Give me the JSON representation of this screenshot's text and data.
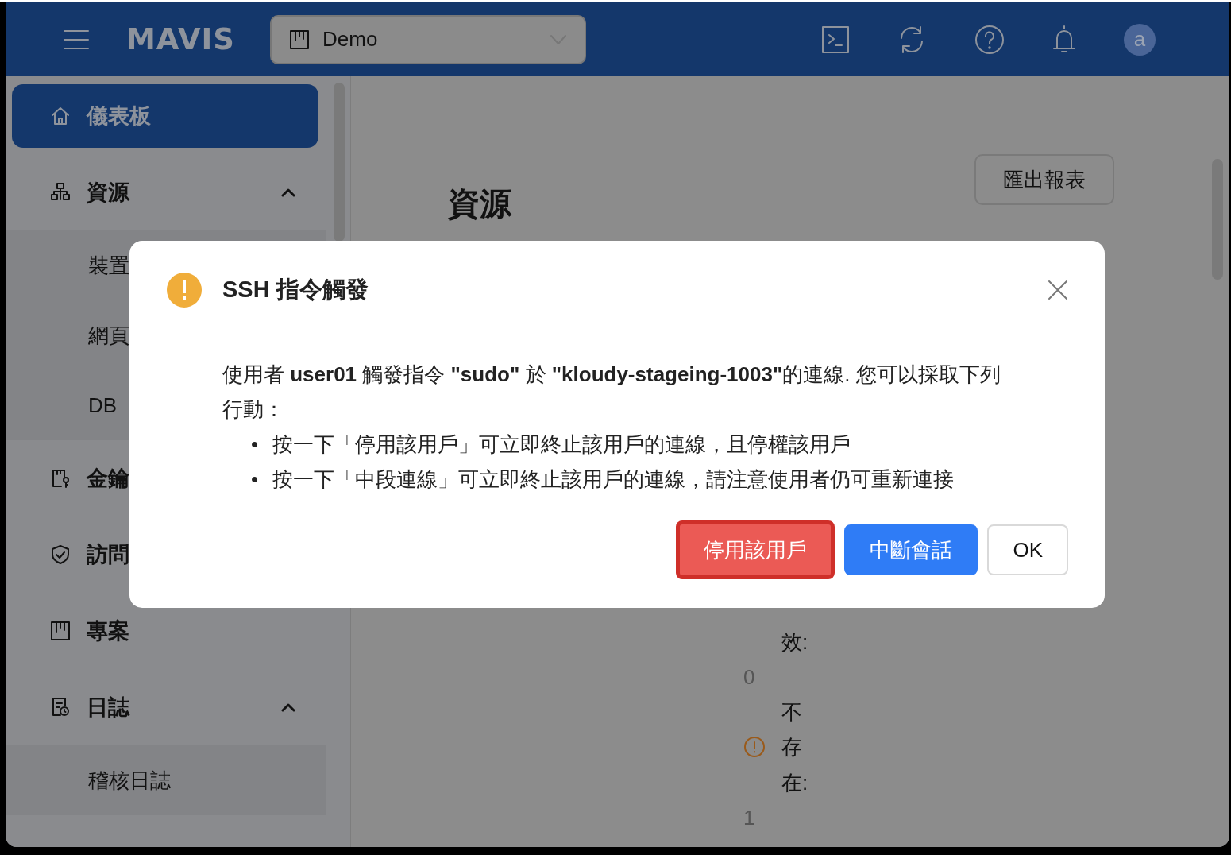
{
  "header": {
    "logo": "MAVIS",
    "project_selector": {
      "value": "Demo"
    },
    "avatar": "a"
  },
  "sidebar": {
    "items": [
      {
        "label": "儀表板",
        "selected": true
      },
      {
        "label": "資源",
        "selected": false,
        "expanded": true,
        "children": [
          {
            "label": "裝置",
            "selected": false
          },
          {
            "label": "網頁",
            "selected": false
          },
          {
            "label": "DB",
            "selected": false
          }
        ]
      },
      {
        "label": "金鑰",
        "selected": false
      },
      {
        "label": "訪問",
        "selected": false
      },
      {
        "label": "專案",
        "selected": false
      },
      {
        "label": "日誌",
        "selected": false,
        "expanded": true,
        "children": [
          {
            "label": "稽核日誌",
            "selected": false
          }
        ]
      }
    ]
  },
  "content": {
    "title": "資源",
    "export_button": "匯出報表",
    "stats": [
      {
        "label": "效:",
        "value": "0",
        "warning": false
      },
      {
        "label": "不存在:",
        "value": "1",
        "warning": true
      }
    ]
  },
  "dialog": {
    "title": "SSH 指令觸發",
    "message": "使用者 **user01** 觸發指令 **\"sudo\"** 於 **\"kloudy-stageing-1003\"**的連線. 您可以採取下列行動：",
    "bullets": [
      {
        "marker": "•",
        "text": "按一下「停用該用戶」可立即終止該用戶的連線，且停權該用戶"
      },
      {
        "marker": "•",
        "text": "按一下「中段連線」可立即終止該用戶的連線，請注意使用者仍可重新連接"
      }
    ],
    "buttons": [
      {
        "label": "停用該用戶",
        "kind": "danger",
        "focused": true
      },
      {
        "label": "中斷會話",
        "kind": "primary",
        "focused": false
      },
      {
        "label": "OK",
        "kind": "default",
        "focused": false
      }
    ]
  }
}
